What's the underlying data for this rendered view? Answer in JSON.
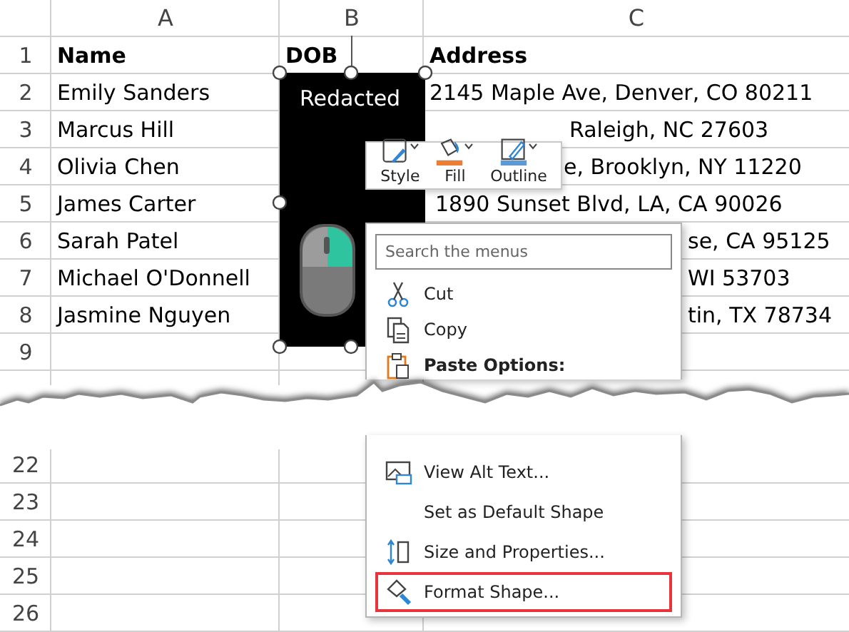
{
  "sheet": {
    "columns": [
      "A",
      "B",
      "C"
    ],
    "header_row": {
      "number": "1",
      "cells": [
        "Name",
        "DOB",
        "Address"
      ]
    },
    "rows_above_tear": [
      {
        "number": "2",
        "cells": [
          "Emily Sanders",
          null,
          "2145 Maple Ave, Denver, CO 80211"
        ]
      },
      {
        "number": "3",
        "cells": [
          "Marcus Hill",
          null,
          "Raleigh, NC 27603"
        ]
      },
      {
        "number": "4",
        "cells": [
          "Olivia Chen",
          null,
          "e, Brooklyn, NY 11220"
        ]
      },
      {
        "number": "5",
        "cells": [
          "James Carter",
          null,
          "1890 Sunset Blvd, LA, CA 90026"
        ]
      },
      {
        "number": "6",
        "cells": [
          "Sarah Patel",
          null,
          "se, CA 95125"
        ]
      },
      {
        "number": "7",
        "cells": [
          "Michael O'Donnell",
          null,
          "WI 53703"
        ]
      },
      {
        "number": "8",
        "cells": [
          "Jasmine Nguyen",
          null,
          "tin, TX 78734"
        ]
      },
      {
        "number": "9"
      }
    ],
    "rows_below_tear": [
      {
        "number": "22"
      },
      {
        "number": "23"
      },
      {
        "number": "24"
      },
      {
        "number": "25"
      },
      {
        "number": "26"
      }
    ]
  },
  "shape": {
    "text": "Redacted"
  },
  "mini_toolbar": {
    "buttons": [
      {
        "label": "Style"
      },
      {
        "label": "Fill",
        "color": "#ed7d31"
      },
      {
        "label": "Outline",
        "color": "#5b9bd5"
      }
    ]
  },
  "context_menu": {
    "search": {
      "placeholder": "Search the menus"
    },
    "items_above_tear": [
      {
        "label": "Cut",
        "highlighted": false
      },
      {
        "label": "Copy",
        "highlighted": false
      }
    ],
    "section_header": "Paste Options:",
    "items_below_tear": [
      {
        "label": "View Alt Text...",
        "highlighted": false
      },
      {
        "label": "Set as Default Shape",
        "highlighted": false
      },
      {
        "label": "Size and Properties...",
        "highlighted": false
      },
      {
        "label": "Format Shape...",
        "highlighted": true
      }
    ]
  }
}
